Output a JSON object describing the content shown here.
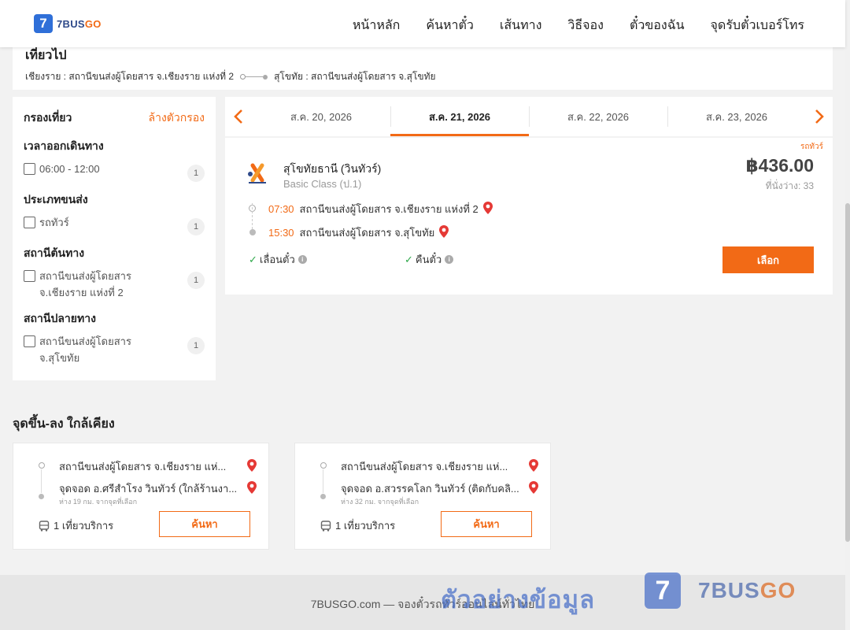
{
  "header": {
    "logo_mark": "7",
    "logo_brand": "7BUS",
    "logo_brand_accent": "GO",
    "nav": [
      "หน้าหลัก",
      "ค้นหาตั๋ว",
      "เส้นทาง",
      "วิธีจอง",
      "ตั๋วของฉัน",
      "จุดรับตั๋วเบอร์โทร"
    ]
  },
  "trip": {
    "title": "เที่ยวไป",
    "origin": "เชียงราย : สถานีขนส่งผู้โดยสาร จ.เชียงราย แห่งที่ 2",
    "destination": "สุโขทัย : สถานีขนส่งผู้โดยสาร จ.สุโขทัย"
  },
  "filters": {
    "title": "กรองเที่ยว",
    "clear": "ล้างตัวกรอง",
    "groups": [
      {
        "title": "เวลาออกเดินทาง",
        "options": [
          {
            "label": "06:00 - 12:00",
            "count": "1"
          }
        ]
      },
      {
        "title": "ประเภทขนส่ง",
        "options": [
          {
            "label": "รถทัวร์",
            "count": "1"
          }
        ]
      },
      {
        "title": "สถานีต้นทาง",
        "options": [
          {
            "label": "สถานีขนส่งผู้โดยสาร จ.เชียงราย แห่งที่ 2",
            "count": "1"
          }
        ]
      },
      {
        "title": "สถานีปลายทาง",
        "options": [
          {
            "label": "สถานีขนส่งผู้โดยสาร จ.สุโขทัย",
            "count": "1"
          }
        ]
      }
    ]
  },
  "dates": {
    "tabs": [
      "ส.ค. 20, 2026",
      "ส.ค. 21, 2026",
      "ส.ค. 22, 2026",
      "ส.ค. 23, 2026"
    ],
    "active_index": 1
  },
  "result": {
    "tag": "รถทัวร์",
    "operator": "สุโขทัยธานี (วินทัวร์)",
    "class": "Basic Class (ป.1)",
    "price": "฿436.00",
    "seats": "ที่นั่งว่าง: 33",
    "depart_time": "07:30",
    "depart_station": "สถานีขนส่งผู้โดยสาร จ.เชียงราย แห่งที่ 2",
    "arrive_time": "15:30",
    "arrive_station": "สถานีขนส่งผู้โดยสาร จ.สุโขทัย",
    "feature_1": "เลื่อนตั๋ว",
    "feature_2": "คืนตั๋ว",
    "select_label": "เลือก"
  },
  "nearby": {
    "title": "จุดขึ้น-ลง ใกล้เคียง",
    "cards": [
      {
        "from": "สถานีขนส่งผู้โดยสาร จ.เชียงราย แห่...",
        "to": "จุดจอด อ.ศรีสำโรง วินทัวร์ (ใกล้ร้านงา...",
        "distance": "ห่าง 19 กม. จากจุดที่เลือก",
        "trips": "1 เที่ยวบริการ",
        "button": "ค้นหา"
      },
      {
        "from": "สถานีขนส่งผู้โดยสาร จ.เชียงราย แห่...",
        "to": "จุดจอด อ.สวรรคโลก วินทัวร์ (ติดกับคลิ...",
        "distance": "ห่าง 32 กม. จากจุดที่เลือก",
        "trips": "1 เที่ยวบริการ",
        "button": "ค้นหา"
      }
    ]
  },
  "footer": {
    "text": "7BUSGO.com — จองตั๋วรถทัวร์ออนไลน์ทั่วไทย",
    "watermark_text": "ตัวอย่างข้อมูล",
    "watermark_mark": "7",
    "watermark_brand": "7BUS",
    "watermark_brand_accent": "GO"
  },
  "colors": {
    "accent": "#f26a16",
    "brand_blue": "#2f6fd8",
    "check_green": "#2ea84a",
    "pin_red": "#e53935"
  }
}
